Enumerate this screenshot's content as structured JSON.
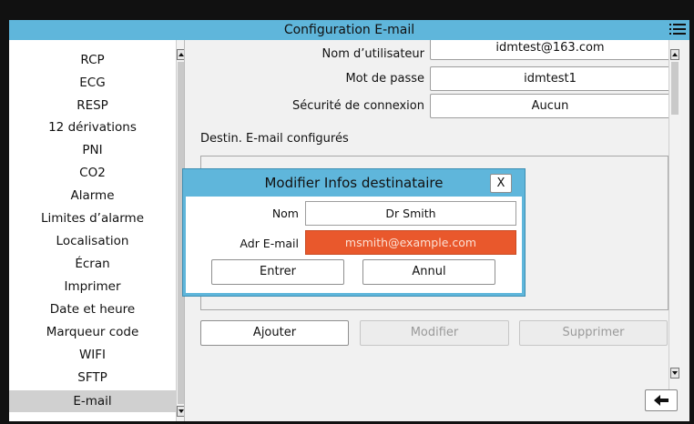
{
  "header": {
    "title": "Configuration E-mail",
    "menu_icon": "list-menu-icon"
  },
  "sidebar": {
    "items": [
      {
        "label": "RCP"
      },
      {
        "label": "ECG"
      },
      {
        "label": "RESP"
      },
      {
        "label": "12 dérivations"
      },
      {
        "label": "PNI"
      },
      {
        "label": "CO2"
      },
      {
        "label": "Alarme"
      },
      {
        "label": "Limites d’alarme"
      },
      {
        "label": "Localisation"
      },
      {
        "label": "Écran"
      },
      {
        "label": "Imprimer"
      },
      {
        "label": "Date et heure"
      },
      {
        "label": "Marqueur code"
      },
      {
        "label": "WIFI"
      },
      {
        "label": "SFTP"
      },
      {
        "label": "E-mail"
      }
    ],
    "active_index": 15
  },
  "settings": {
    "username": {
      "label": "Nom d’utilisateur",
      "value": "idmtest@163.com"
    },
    "password": {
      "label": "Mot de passe",
      "value": "idmtest1"
    },
    "security": {
      "label": "Sécurité de connexion",
      "value": "Aucun"
    }
  },
  "recipients": {
    "label": "Destin. E-mail configurés"
  },
  "actions": {
    "add": "Ajouter",
    "modify": "Modifier",
    "delete": "Supprimer"
  },
  "modal": {
    "title": "Modifier Infos destinataire",
    "close": "X",
    "name_label": "Nom",
    "name_value": "Dr Smith",
    "email_label": "Adr E-mail",
    "email_value": "msmith@example.com",
    "enter": "Entrer",
    "cancel": "Annul"
  },
  "colors": {
    "accent": "#5fb6db",
    "highlight": "#e9582c",
    "active_item": "#d0d0d0"
  },
  "back_icon": "left-arrow-icon"
}
